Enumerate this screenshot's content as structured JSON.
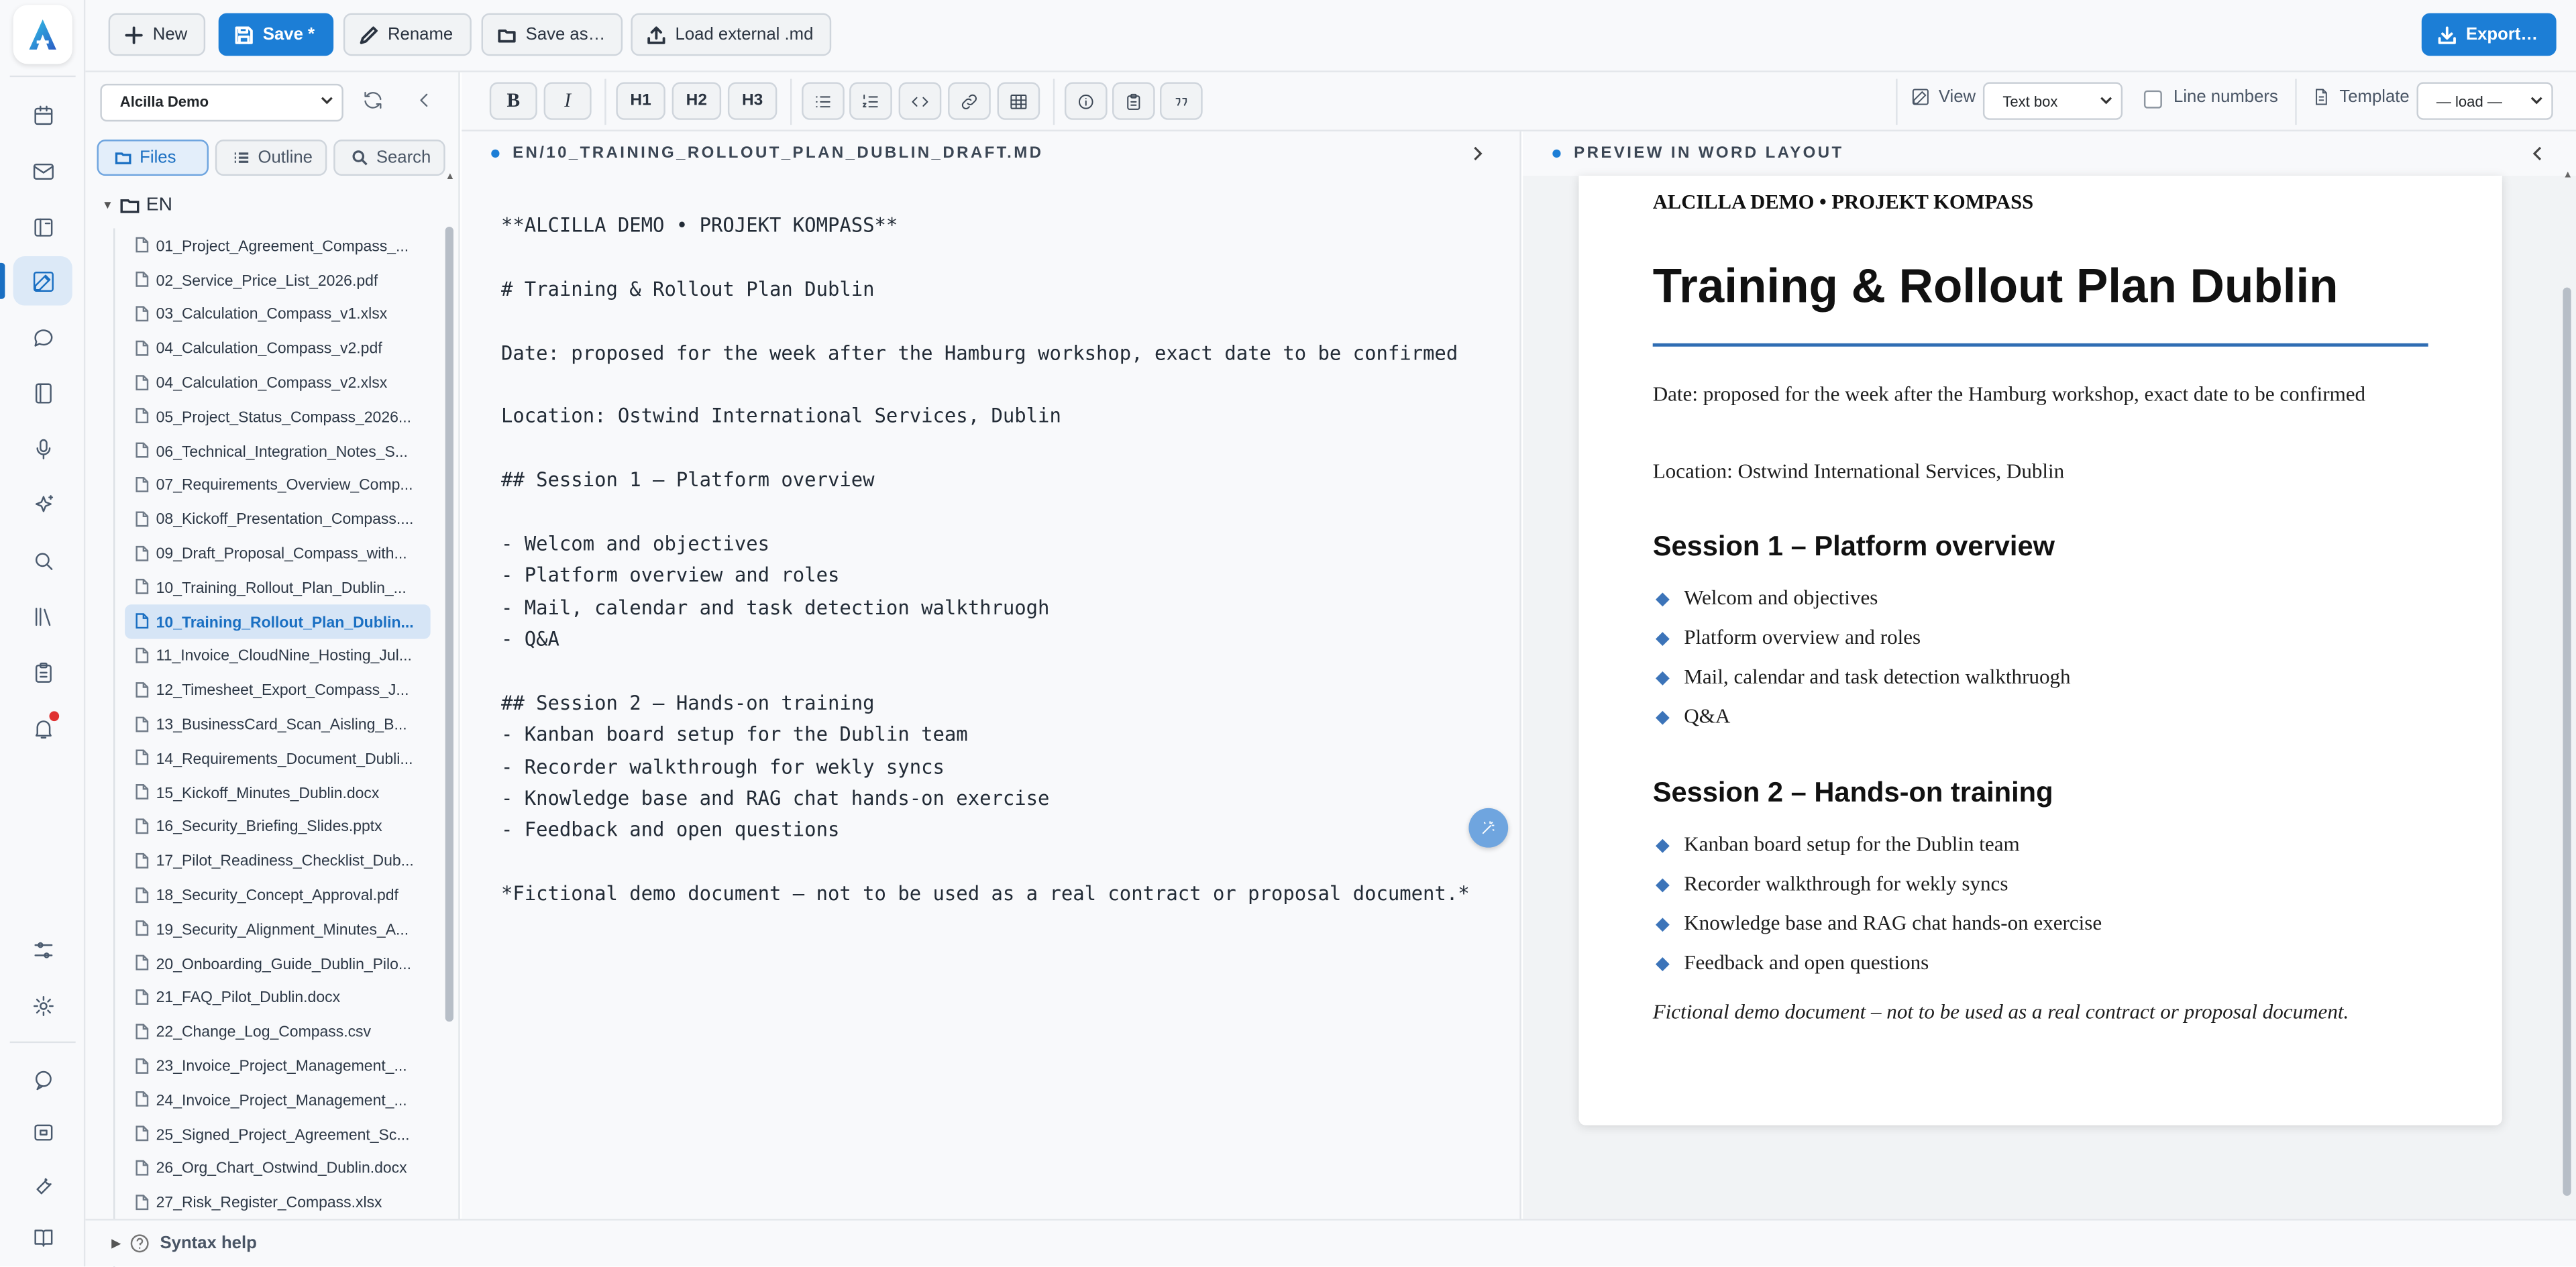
{
  "toolbar": {
    "new_label": "New",
    "save_label": "Save *",
    "rename_label": "Rename",
    "save_as_label": "Save as…",
    "load_external_label": "Load external .md",
    "export_label": "Export…"
  },
  "sidebar": {
    "project": "Alcilla Demo",
    "tabs": [
      "Files",
      "Outline",
      "Search"
    ],
    "root_folder": "EN",
    "files": [
      "01_Project_Agreement_Compass_...",
      "02_Service_Price_List_2026.pdf",
      "03_Calculation_Compass_v1.xlsx",
      "04_Calculation_Compass_v2.pdf",
      "04_Calculation_Compass_v2.xlsx",
      "05_Project_Status_Compass_2026...",
      "06_Technical_Integration_Notes_S...",
      "07_Requirements_Overview_Comp...",
      "08_Kickoff_Presentation_Compass....",
      "09_Draft_Proposal_Compass_with...",
      "10_Training_Rollout_Plan_Dublin_...",
      "10_Training_Rollout_Plan_Dublin...",
      "11_Invoice_CloudNine_Hosting_Jul...",
      "12_Timesheet_Export_Compass_J...",
      "13_BusinessCard_Scan_Aisling_B...",
      "14_Requirements_Document_Dubli...",
      "15_Kickoff_Minutes_Dublin.docx",
      "16_Security_Briefing_Slides.pptx",
      "17_Pilot_Readiness_Checklist_Dub...",
      "18_Security_Concept_Approval.pdf",
      "19_Security_Alignment_Minutes_A...",
      "20_Onboarding_Guide_Dublin_Pilo...",
      "21_FAQ_Pilot_Dublin.docx",
      "22_Change_Log_Compass.csv",
      "23_Invoice_Project_Management_...",
      "24_Invoice_Project_Management_...",
      "25_Signed_Project_Agreement_Sc...",
      "26_Org_Chart_Ostwind_Dublin.docx",
      "27_Risk_Register_Compass.xlsx"
    ],
    "active_file_index": 11,
    "syntax_help": "Syntax help"
  },
  "format_bar": {
    "bold": "B",
    "italic": "I",
    "h1": "H1",
    "h2": "H2",
    "h3": "H3",
    "view_label": "View",
    "view_mode": "Text box",
    "line_numbers_label": "Line numbers",
    "template_label": "Template",
    "template_value": "— load —"
  },
  "editor": {
    "path": "EN/10_TRAINING_ROLLOUT_PLAN_DUBLIN_DRAFT.MD",
    "lines": [
      "**ALCILLA DEMO • PROJEKT KOMPASS**",
      "",
      "# Training & Rollout Plan Dublin",
      "",
      "Date: proposed for the week after the Hamburg workshop, exact date to be confirmed",
      "",
      "Location: Ostwind International Services, Dublin",
      "",
      "## Session 1 – Platform overview",
      "",
      "- Welcom and objectives",
      "- Platform overview and roles",
      "- Mail, calendar and task detection walkthruogh",
      "- Q&A",
      "",
      "## Session 2 – Hands-on training",
      "- Kanban board setup for the Dublin team",
      "- Recorder walkthrough for wekly syncs",
      "- Knowledge base and RAG chat hands-on exercise",
      "- Feedback and open questions",
      "",
      "*Fictional demo document – not to be used as a real contract or proposal document.*"
    ]
  },
  "preview": {
    "header": "PREVIEW IN WORD LAYOUT",
    "kicker": "ALCILLA DEMO • PROJEKT KOMPASS",
    "title": "Training & Rollout Plan Dublin",
    "date": "Date: proposed for the week after the Hamburg workshop, exact date to be confirmed",
    "location": "Location: Ostwind International Services, Dublin",
    "session1_title": "Session 1 – Platform overview",
    "session1_items": [
      "Welcom and objectives",
      "Platform overview and roles",
      "Mail, calendar and task detection walkthruogh",
      "Q&A"
    ],
    "session2_title": "Session 2 – Hands-on training",
    "session2_items": [
      "Kanban board setup for the Dublin team",
      "Recorder walkthrough for wekly syncs",
      "Knowledge base and RAG chat hands-on exercise",
      "Feedback and open questions"
    ],
    "footer": "Fictional demo document – not to be used as a real contract or proposal document."
  },
  "colors": {
    "accent": "#1c7ed6",
    "rule": "#2f6db3",
    "notification": "#e03131"
  }
}
